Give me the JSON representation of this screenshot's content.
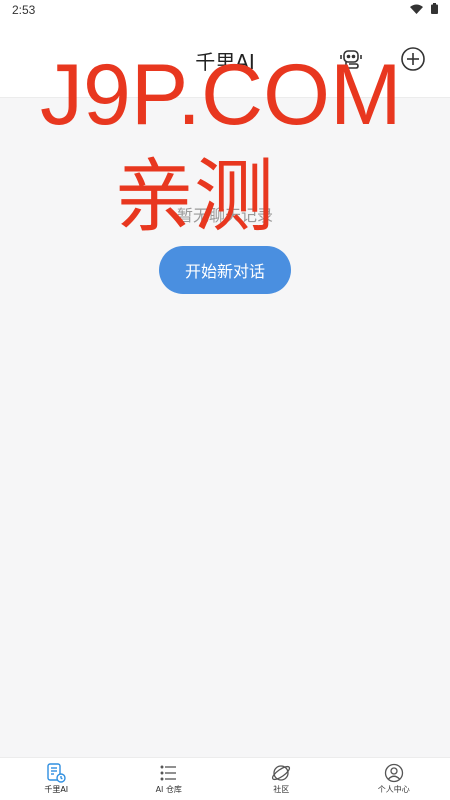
{
  "status_bar": {
    "time": "2:53"
  },
  "header": {
    "title": "千里AI"
  },
  "main": {
    "empty_text": "暂无聊天记录",
    "start_button": "开始新对话"
  },
  "watermark": {
    "line1": "J9P.COM",
    "line2": "亲测"
  },
  "tabs": [
    {
      "label": "千里AI",
      "icon": "chat-doc-icon"
    },
    {
      "label": "AI 仓库",
      "icon": "list-icon"
    },
    {
      "label": "社区",
      "icon": "planet-icon"
    },
    {
      "label": "个人中心",
      "icon": "user-circle-icon"
    }
  ],
  "colors": {
    "accent": "#4a8fe0",
    "watermark": "#e8371f",
    "background": "#f6f6f7"
  }
}
